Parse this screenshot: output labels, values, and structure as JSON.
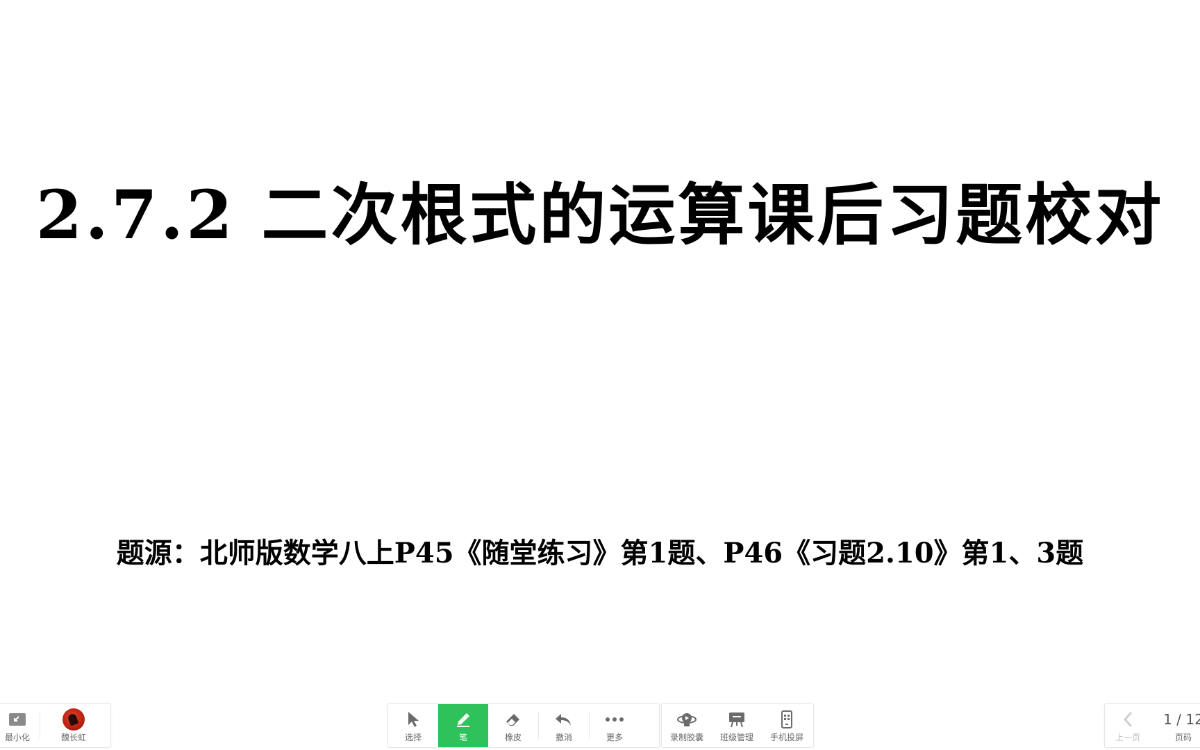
{
  "slide": {
    "title": "2.7.2  二次根式的运算课后习题校对",
    "subtitle": "题源：北师版数学八上P45《随堂练习》第1题、P46《习题2.10》第1、3题"
  },
  "toolbar": {
    "minimize_label": "最小化",
    "user_name": "魏长虹",
    "select_label": "选择",
    "pen_label": "笔",
    "eraser_label": "橡皮",
    "undo_label": "撤消",
    "more_label": "更多",
    "record_label": "录制胶囊",
    "class_label": "班级管理",
    "phone_label": "手机投屏",
    "prev_label": "上一页",
    "page_indicator": "1 / 12",
    "page_label": "页码"
  },
  "colors": {
    "active": "#2fc25b",
    "icon": "#666666"
  },
  "icons": {
    "minimize": "minimize-icon",
    "select": "cursor-icon",
    "pen": "pen-icon",
    "eraser": "eraser-icon",
    "undo": "undo-icon",
    "more": "more-dots-icon",
    "record": "record-capsule-icon",
    "class": "class-manage-icon",
    "phone": "phone-cast-icon",
    "prev": "chevron-left-icon"
  }
}
